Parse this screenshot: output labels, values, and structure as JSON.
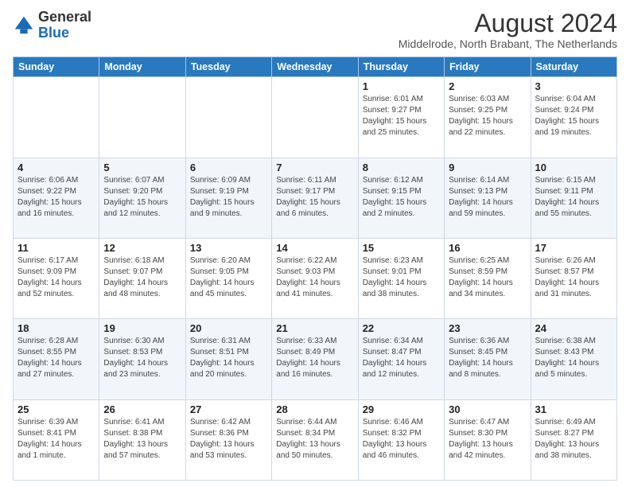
{
  "header": {
    "logo": {
      "general": "General",
      "blue": "Blue"
    },
    "title": "August 2024",
    "subtitle": "Middelrode, North Brabant, The Netherlands"
  },
  "calendar": {
    "weekdays": [
      "Sunday",
      "Monday",
      "Tuesday",
      "Wednesday",
      "Thursday",
      "Friday",
      "Saturday"
    ],
    "weeks": [
      [
        {
          "day": "",
          "info": ""
        },
        {
          "day": "",
          "info": ""
        },
        {
          "day": "",
          "info": ""
        },
        {
          "day": "",
          "info": ""
        },
        {
          "day": "1",
          "info": "Sunrise: 6:01 AM\nSunset: 9:27 PM\nDaylight: 15 hours\nand 25 minutes."
        },
        {
          "day": "2",
          "info": "Sunrise: 6:03 AM\nSunset: 9:25 PM\nDaylight: 15 hours\nand 22 minutes."
        },
        {
          "day": "3",
          "info": "Sunrise: 6:04 AM\nSunset: 9:24 PM\nDaylight: 15 hours\nand 19 minutes."
        }
      ],
      [
        {
          "day": "4",
          "info": "Sunrise: 6:06 AM\nSunset: 9:22 PM\nDaylight: 15 hours\nand 16 minutes."
        },
        {
          "day": "5",
          "info": "Sunrise: 6:07 AM\nSunset: 9:20 PM\nDaylight: 15 hours\nand 12 minutes."
        },
        {
          "day": "6",
          "info": "Sunrise: 6:09 AM\nSunset: 9:19 PM\nDaylight: 15 hours\nand 9 minutes."
        },
        {
          "day": "7",
          "info": "Sunrise: 6:11 AM\nSunset: 9:17 PM\nDaylight: 15 hours\nand 6 minutes."
        },
        {
          "day": "8",
          "info": "Sunrise: 6:12 AM\nSunset: 9:15 PM\nDaylight: 15 hours\nand 2 minutes."
        },
        {
          "day": "9",
          "info": "Sunrise: 6:14 AM\nSunset: 9:13 PM\nDaylight: 14 hours\nand 59 minutes."
        },
        {
          "day": "10",
          "info": "Sunrise: 6:15 AM\nSunset: 9:11 PM\nDaylight: 14 hours\nand 55 minutes."
        }
      ],
      [
        {
          "day": "11",
          "info": "Sunrise: 6:17 AM\nSunset: 9:09 PM\nDaylight: 14 hours\nand 52 minutes."
        },
        {
          "day": "12",
          "info": "Sunrise: 6:18 AM\nSunset: 9:07 PM\nDaylight: 14 hours\nand 48 minutes."
        },
        {
          "day": "13",
          "info": "Sunrise: 6:20 AM\nSunset: 9:05 PM\nDaylight: 14 hours\nand 45 minutes."
        },
        {
          "day": "14",
          "info": "Sunrise: 6:22 AM\nSunset: 9:03 PM\nDaylight: 14 hours\nand 41 minutes."
        },
        {
          "day": "15",
          "info": "Sunrise: 6:23 AM\nSunset: 9:01 PM\nDaylight: 14 hours\nand 38 minutes."
        },
        {
          "day": "16",
          "info": "Sunrise: 6:25 AM\nSunset: 8:59 PM\nDaylight: 14 hours\nand 34 minutes."
        },
        {
          "day": "17",
          "info": "Sunrise: 6:26 AM\nSunset: 8:57 PM\nDaylight: 14 hours\nand 31 minutes."
        }
      ],
      [
        {
          "day": "18",
          "info": "Sunrise: 6:28 AM\nSunset: 8:55 PM\nDaylight: 14 hours\nand 27 minutes."
        },
        {
          "day": "19",
          "info": "Sunrise: 6:30 AM\nSunset: 8:53 PM\nDaylight: 14 hours\nand 23 minutes."
        },
        {
          "day": "20",
          "info": "Sunrise: 6:31 AM\nSunset: 8:51 PM\nDaylight: 14 hours\nand 20 minutes."
        },
        {
          "day": "21",
          "info": "Sunrise: 6:33 AM\nSunset: 8:49 PM\nDaylight: 14 hours\nand 16 minutes."
        },
        {
          "day": "22",
          "info": "Sunrise: 6:34 AM\nSunset: 8:47 PM\nDaylight: 14 hours\nand 12 minutes."
        },
        {
          "day": "23",
          "info": "Sunrise: 6:36 AM\nSunset: 8:45 PM\nDaylight: 14 hours\nand 8 minutes."
        },
        {
          "day": "24",
          "info": "Sunrise: 6:38 AM\nSunset: 8:43 PM\nDaylight: 14 hours\nand 5 minutes."
        }
      ],
      [
        {
          "day": "25",
          "info": "Sunrise: 6:39 AM\nSunset: 8:41 PM\nDaylight: 14 hours\nand 1 minute."
        },
        {
          "day": "26",
          "info": "Sunrise: 6:41 AM\nSunset: 8:38 PM\nDaylight: 13 hours\nand 57 minutes."
        },
        {
          "day": "27",
          "info": "Sunrise: 6:42 AM\nSunset: 8:36 PM\nDaylight: 13 hours\nand 53 minutes."
        },
        {
          "day": "28",
          "info": "Sunrise: 6:44 AM\nSunset: 8:34 PM\nDaylight: 13 hours\nand 50 minutes."
        },
        {
          "day": "29",
          "info": "Sunrise: 6:46 AM\nSunset: 8:32 PM\nDaylight: 13 hours\nand 46 minutes."
        },
        {
          "day": "30",
          "info": "Sunrise: 6:47 AM\nSunset: 8:30 PM\nDaylight: 13 hours\nand 42 minutes."
        },
        {
          "day": "31",
          "info": "Sunrise: 6:49 AM\nSunset: 8:27 PM\nDaylight: 13 hours\nand 38 minutes."
        }
      ]
    ]
  }
}
